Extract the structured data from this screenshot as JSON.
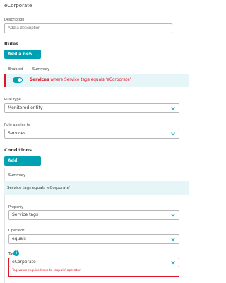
{
  "page_title": "eCorporate",
  "description": {
    "label": "Description",
    "placeholder": "Add a description"
  },
  "rules": {
    "heading": "Rules",
    "add_button": "Add a new rule",
    "col_enabled": "Enabled",
    "col_summary": "Summary",
    "row": {
      "enabled": true,
      "entity": "Services",
      "text": "where Service tags equals 'eCorporate'"
    }
  },
  "rule_type": {
    "label": "Rule type",
    "value": "Monitored entity"
  },
  "rule_applies_to": {
    "label": "Rule applies to",
    "value": "Services"
  },
  "conditions": {
    "heading": "Conditions",
    "add_button": "Add condition",
    "summary_label": "Summary",
    "summary_text": "Service tags equals 'eCorporate'",
    "property": {
      "label": "Property",
      "value": "Service tags"
    },
    "operator": {
      "label": "Operator",
      "value": "equals"
    },
    "tag": {
      "label": "Tag",
      "value": "eCorporate",
      "error": "Tag value required due to 'equals' operator"
    }
  },
  "colors": {
    "accent": "#00a1b2",
    "error": "#dc172a",
    "highlight_bg": "#e6f6f8"
  },
  "icons": {
    "chevron": "chevron-down-icon",
    "info": "info-icon"
  }
}
